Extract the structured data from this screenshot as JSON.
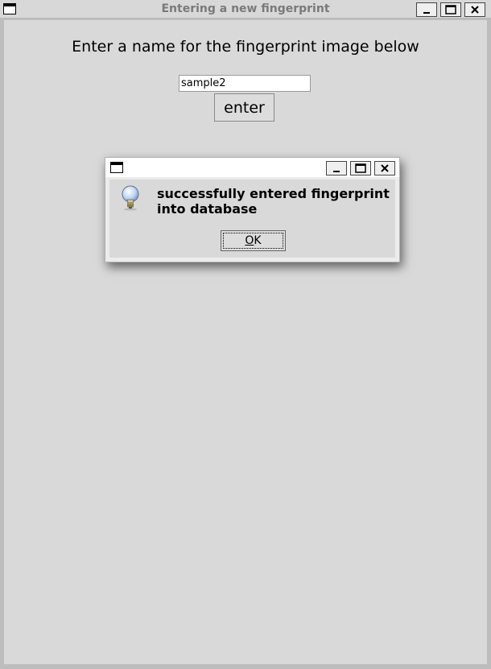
{
  "window": {
    "title": "Entering a new fingerprint",
    "icon": "window-icon",
    "controls": [
      "minimize-icon",
      "maximize-icon",
      "close-icon"
    ]
  },
  "form": {
    "prompt": "Enter a name for the fingerprint image below",
    "name_value": "sample2",
    "enter_label": "enter"
  },
  "dialog": {
    "icon": "lightbulb-icon",
    "message": "successfully entered fingerprint into database",
    "ok_mnemonic": "O",
    "ok_rest": "K"
  }
}
